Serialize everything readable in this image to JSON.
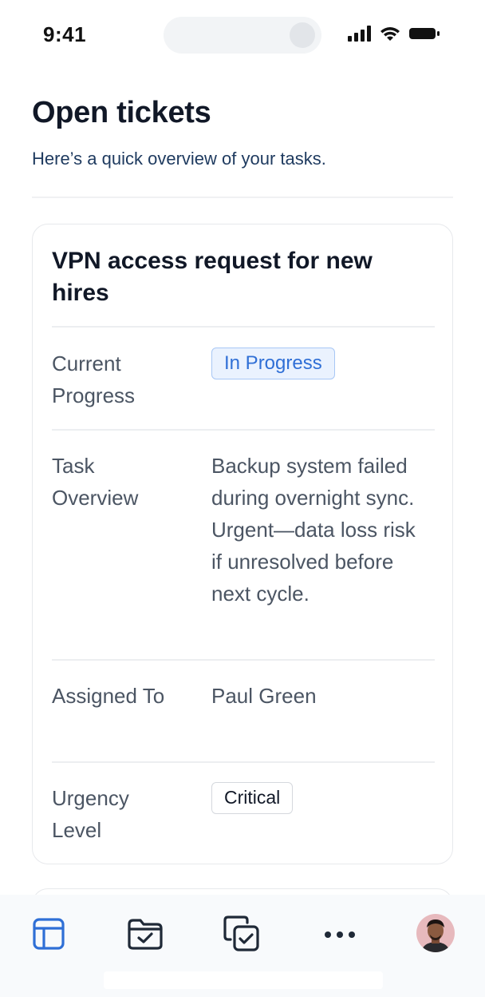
{
  "status_bar": {
    "time": "9:41",
    "icons": [
      "cellular-signal-icon",
      "wifi-icon",
      "battery-icon"
    ]
  },
  "header": {
    "title": "Open tickets",
    "subtitle": "Here’s a quick overview of your tasks."
  },
  "ticket": {
    "title": "VPN access request for new hires",
    "rows": [
      {
        "label": "Current Progress",
        "value": "In Progress",
        "type": "badge"
      },
      {
        "label": "Task Overview",
        "value": "Backup system failed during overnight sync. Urgent—data loss risk if unresolved before next cycle.",
        "type": "text"
      },
      {
        "label": "Assigned To",
        "value": "Paul Green",
        "type": "text"
      },
      {
        "label": "Urgency Level",
        "value": "Critical",
        "type": "badge"
      }
    ]
  },
  "tab_bar": {
    "items": [
      {
        "icon": "layout-icon",
        "active": true
      },
      {
        "icon": "folder-check-icon",
        "active": false
      },
      {
        "icon": "copy-check-icon",
        "active": false
      },
      {
        "icon": "more-horizontal-icon",
        "active": false
      },
      {
        "icon": "profile-avatar",
        "active": false
      }
    ]
  },
  "colors": {
    "accent": "#2f6fd6",
    "badge_progress_bg": "#eaf2fe",
    "text_primary": "#111827",
    "text_secondary": "#4b5563",
    "subtitle": "#1e3a5f"
  }
}
